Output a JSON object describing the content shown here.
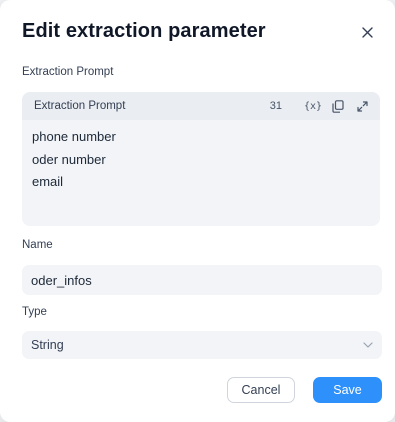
{
  "dialog": {
    "title": "Edit extraction parameter",
    "close_icon": "close-icon"
  },
  "extraction_prompt": {
    "label": "Extraction Prompt",
    "editor_title": "Extraction Prompt",
    "char_count": "31",
    "variable_icon_label": "{x}",
    "lines": [
      "phone number",
      "oder number",
      "email"
    ],
    "icons": [
      "variable-icon",
      "copy-icon",
      "expand-icon"
    ]
  },
  "name_field": {
    "label": "Name",
    "value": "oder_infos"
  },
  "type_field": {
    "label": "Type",
    "value": "String",
    "icon": "chevron-down-icon"
  },
  "actions": {
    "cancel_label": "Cancel",
    "save_label": "Save"
  },
  "colors": {
    "primary": "#2e90fa",
    "field_bg": "#f2f4f7",
    "text": "#1d2939"
  }
}
